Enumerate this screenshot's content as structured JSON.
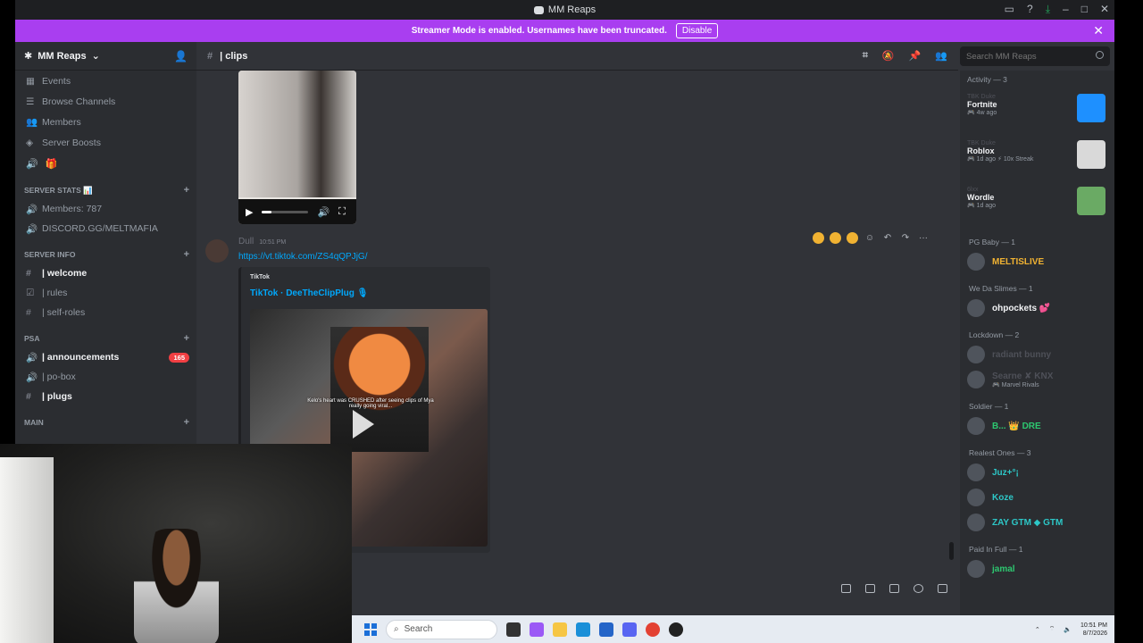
{
  "window": {
    "title": "MM Reaps"
  },
  "banner": {
    "text": "Streamer Mode is enabled. Usernames have been truncated.",
    "disable_label": "Disable",
    "color": "#a93ef0"
  },
  "guild": {
    "name": "MM Reaps"
  },
  "sidebar": {
    "links": [
      {
        "label": "Events",
        "icon": "calendar-icon"
      },
      {
        "label": "Browse Channels",
        "icon": "browse-icon"
      },
      {
        "label": "Members",
        "icon": "members-icon"
      },
      {
        "label": "Server Boosts",
        "icon": "boost-icon"
      }
    ],
    "categories": [
      {
        "name": "SERVER STATS 📊",
        "channels": [
          {
            "label": "Members: 787",
            "icon": "speaker-icon",
            "bold": false
          },
          {
            "label": "DISCORD.GG/MELTMAFIA",
            "icon": "speaker-icon",
            "bold": false
          }
        ]
      },
      {
        "name": "SERVER INFO",
        "channels": [
          {
            "label": "| welcome",
            "icon": "hash-icon",
            "bold": true
          },
          {
            "label": "| rules",
            "icon": "rules-icon",
            "bold": false
          },
          {
            "label": "| self-roles",
            "icon": "hash-icon",
            "bold": false
          }
        ]
      },
      {
        "name": "PSA",
        "channels": [
          {
            "label": "| announcements",
            "icon": "speaker-icon",
            "bold": true,
            "badge": "165"
          },
          {
            "label": "| po-box",
            "icon": "speaker-icon",
            "bold": false
          },
          {
            "label": "| plugs",
            "icon": "hash-icon",
            "bold": true
          }
        ]
      },
      {
        "name": "MAIN",
        "channels": []
      }
    ]
  },
  "channel": {
    "name": "| clips"
  },
  "search": {
    "placeholder": "Search MM Reaps"
  },
  "message": {
    "username": "Dull",
    "timestamp": "10:51 PM",
    "link": "https://vt.tiktok.com/ZS4qQPJjG/",
    "embed": {
      "provider": "TikTok",
      "title": "TikTok · DeeTheClipPlug 🎙",
      "caption": "Kelo's heart was CRUSHED after seeing clips of Mya really going viral..."
    }
  },
  "members_panel": {
    "activity_header": "Activity — 3",
    "activities": [
      {
        "user": "TBK Duke",
        "game": "Fortnite",
        "meta": "🎮 4w ago",
        "color": "#1e90ff"
      },
      {
        "user": "TBK Duke",
        "game": "Roblox",
        "meta": "🎮 1d ago  ⚡ 10x Streak",
        "color": "#d9d9d9"
      },
      {
        "user": "6lxx",
        "game": "Wordle",
        "meta": "🎮 1d ago",
        "color": "#6aaa64"
      }
    ],
    "roles": [
      {
        "name": "PG Baby — 1",
        "members": [
          {
            "name": "MELTISLIVE",
            "color": "#f0b232",
            "sub": ""
          }
        ]
      },
      {
        "name": "We Da Slimes — 1",
        "members": [
          {
            "name": "ohpockets 💕",
            "color": "#f2f3f5",
            "sub": ""
          }
        ]
      },
      {
        "name": "Lockdown — 2",
        "members": [
          {
            "name": "radiant bunny",
            "color": "#4e5058",
            "sub": ""
          },
          {
            "name": "Searne  ✘ KNX",
            "color": "#4e5058",
            "sub": "🎮 Marvel Rivals"
          }
        ]
      },
      {
        "name": "Soldier — 1",
        "members": [
          {
            "name": "B...  👑 DRE",
            "color": "#2dc770",
            "sub": ""
          }
        ]
      },
      {
        "name": "Realest Ones — 3",
        "members": [
          {
            "name": "Juz+°¡",
            "color": "#2dc7c7",
            "sub": ""
          },
          {
            "name": "Koze",
            "color": "#2dc7c7",
            "sub": ""
          },
          {
            "name": "ZAY GTM  ◆ GTM",
            "color": "#2dc7c7",
            "sub": ""
          }
        ]
      },
      {
        "name": "Paid In Full — 1",
        "members": [
          {
            "name": "jamal",
            "color": "#2dc770",
            "sub": ""
          }
        ]
      }
    ]
  },
  "taskbar": {
    "search_label": "Search",
    "time": "10:51 PM",
    "date": "8/7/2026"
  }
}
